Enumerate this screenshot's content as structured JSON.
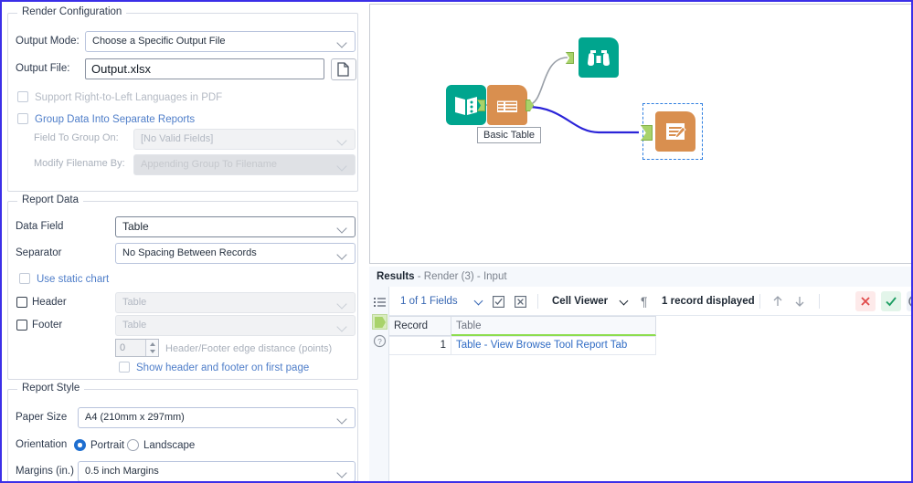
{
  "config": {
    "render_configuration": {
      "legend": "Render Configuration",
      "output_mode_label": "Output Mode:",
      "output_mode_value": "Choose a Specific Output File",
      "output_file_label": "Output File:",
      "output_file_value": "Output.xlsx",
      "browse_icon": "file-icon",
      "rtl_checkbox_label": "Support Right-to-Left Languages in PDF",
      "group_data_checkbox_label": "Group Data Into Separate Reports",
      "field_to_group_label": "Field To Group On:",
      "field_to_group_value": "[No Valid Fields]",
      "modify_filename_label": "Modify Filename By:",
      "modify_filename_value": "Appending Group To Filename"
    },
    "report_data": {
      "legend": "Report Data",
      "data_field_label": "Data Field",
      "data_field_value": "Table",
      "separator_label": "Separator",
      "separator_value": "No Spacing Between Records",
      "static_chart_label": "Use static chart",
      "header_label": "Header",
      "header_value": "Table",
      "footer_label": "Footer",
      "footer_value": "Table",
      "edge_distance_value": "0",
      "edge_distance_label": "Header/Footer edge distance (points)",
      "show_header_footer_label": "Show header and footer on first page"
    },
    "report_style": {
      "legend": "Report Style",
      "paper_size_label": "Paper Size",
      "paper_size_value": "A4 (210mm x 297mm)",
      "orientation_label": "Orientation",
      "orientation_portrait": "Portrait",
      "orientation_landscape": "Landscape",
      "margins_label": "Margins (in.)",
      "margins_value": "0.5 inch Margins"
    }
  },
  "canvas": {
    "tools": [
      {
        "name": "input-data-tool",
        "icon": "book-icon",
        "color": "#00a58e"
      },
      {
        "name": "basic-table-tool",
        "icon": "table-icon",
        "color": "#d98f4f",
        "label": "Basic Table"
      },
      {
        "name": "browse-tool",
        "icon": "binoculars-icon",
        "color": "#00a58e"
      },
      {
        "name": "render-tool",
        "icon": "document-pencil-icon",
        "color": "#d98f4f",
        "selected": true
      }
    ]
  },
  "results": {
    "title_bold": "Results",
    "title_rest": " - Render (3) - Input",
    "sidebar_icons": [
      "list-icon",
      "connector-icon",
      "help-icon"
    ],
    "toolbar": {
      "fields_label": "1 of 1 Fields",
      "select_all_icon": "check-square-icon",
      "deselect_all_icon": "x-square-icon",
      "viewer_label": "Cell Viewer",
      "pilcrow_icon": "pilcrow-icon",
      "record_count": "1 record displayed",
      "up_icon": "arrow-up-icon",
      "down_icon": "arrow-down-icon",
      "close_icon": "x-red-icon",
      "accept_icon": "check-green-icon",
      "extra_icon": "circle-icon"
    },
    "grid": {
      "columns": [
        "Record",
        "Table"
      ],
      "rows": [
        {
          "record": "1",
          "table": "Table - View Browse Tool Report Tab"
        }
      ]
    }
  },
  "colors": {
    "accent_blue": "#3767b3",
    "link_blue": "#4f7ec9",
    "teal": "#00a58e",
    "orange": "#d98f4f",
    "anchor_green": "#a8d36a",
    "selection_blue": "#2f7fe0",
    "frame_purple": "#3b2fe8"
  }
}
